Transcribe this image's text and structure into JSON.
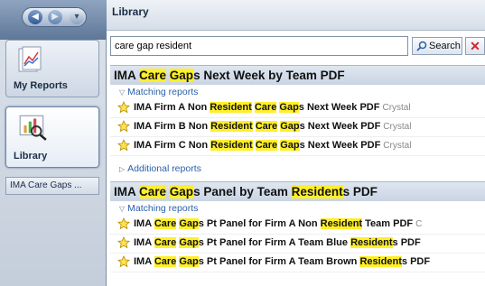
{
  "nav": {
    "items": [
      {
        "label": "My Reports"
      },
      {
        "label": "Library"
      }
    ],
    "recent": "IMA Care Gaps ..."
  },
  "main": {
    "title": "Library",
    "search": {
      "value": "care gap resident",
      "button": "Search"
    }
  },
  "groups": [
    {
      "title": "IMA Care Gaps Next Week by Team PDF",
      "matching_label": "Matching reports",
      "items": [
        {
          "text": "IMA Firm A Non Resident Care Gaps Next Week PDF",
          "tag": "Crystal"
        },
        {
          "text": "IMA Firm B Non Resident Care Gaps Next Week PDF",
          "tag": "Crystal"
        },
        {
          "text": "IMA Firm C Non Resident Care Gaps Next Week PDF",
          "tag": "Crystal"
        }
      ],
      "additional_label": "Additional reports"
    },
    {
      "title": "IMA Care Gaps Panel by Team Residents PDF",
      "matching_label": "Matching reports",
      "items": [
        {
          "text": "IMA Care Gaps Pt Panel for Firm A Non Resident Team PDF",
          "tag": "C"
        },
        {
          "text": "IMA Care Gaps Pt Panel for Firm A Team Blue Residents PDF",
          "tag": ""
        },
        {
          "text": "IMA Care Gaps Pt Panel for Firm A Team Brown Residents PDF",
          "tag": ""
        }
      ]
    }
  ],
  "highlight_terms": [
    "Care",
    "Gap",
    "Resident"
  ],
  "colors": {
    "highlight": "#ffef2a",
    "link": "#2a5fa8",
    "clear": "#d0242a"
  }
}
